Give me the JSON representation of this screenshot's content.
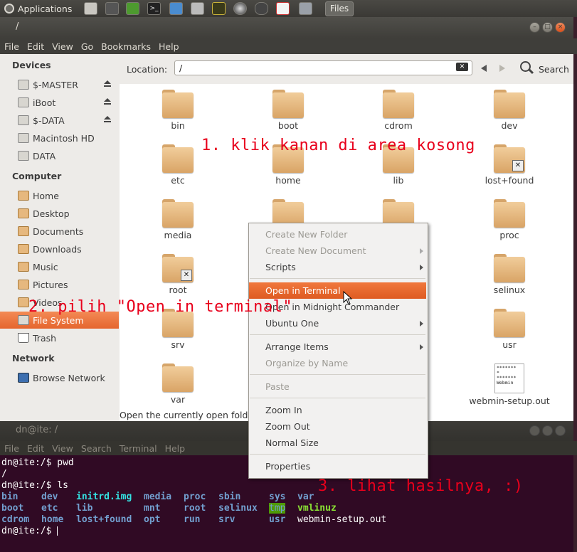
{
  "panel": {
    "applications_label": "Applications",
    "files_task": "Files"
  },
  "nautilus": {
    "title": "/",
    "menu": [
      "File",
      "Edit",
      "View",
      "Go",
      "Bookmarks",
      "Help"
    ],
    "location_label": "Location:",
    "location_value": "/",
    "search_label": "Search",
    "status": "Open the currently open folder in a terminal",
    "sidebar": {
      "devices_header": "Devices",
      "devices": [
        "$-MASTER",
        "iBoot",
        "$-DATA",
        "Macintosh HD",
        "DATA"
      ],
      "computer_header": "Computer",
      "computer": [
        "Home",
        "Desktop",
        "Documents",
        "Downloads",
        "Music",
        "Pictures",
        "Videos",
        "File System",
        "Trash"
      ],
      "network_header": "Network",
      "network": [
        "Browse Network"
      ]
    },
    "items": [
      "bin",
      "boot",
      "cdrom",
      "dev",
      "etc",
      "home",
      "lib",
      "lost+found",
      "media",
      "proc",
      "root",
      "selinux",
      "srv",
      "usr",
      "var",
      "webmin-setup.out"
    ],
    "textfile_preview": "*******\n*\n*******\nWebmin"
  },
  "context_menu": [
    "Create New Folder",
    "Create New Document",
    "Scripts",
    "Open in Terminal",
    "Open in Midnight Commander",
    "Ubuntu One",
    "Arrange Items",
    "Organize by Name",
    "Paste",
    "Zoom In",
    "Zoom Out",
    "Normal Size",
    "Properties"
  ],
  "terminal": {
    "title": "dn@ite: /",
    "menu": [
      "File",
      "Edit",
      "View",
      "Search",
      "Terminal",
      "Help"
    ],
    "prompt1": "dn@ite:/$ pwd",
    "out1": "/",
    "prompt2": "dn@ite:/$ ls",
    "ls": [
      [
        "bin",
        "dev",
        "initrd.img",
        "media",
        "proc",
        "sbin",
        "sys",
        "var"
      ],
      [
        "boot",
        "etc",
        "lib",
        "mnt",
        "root",
        "selinux",
        "tmp",
        "vmlinuz"
      ],
      [
        "cdrom",
        "home",
        "lost+found",
        "opt",
        "run",
        "srv",
        "usr",
        "webmin-setup.out"
      ]
    ],
    "prompt3": "dn@ite:/$ "
  },
  "annotations": {
    "step1": "1. klik kanan di area kosong",
    "step2": "2. pilih \"Open in terminal\"",
    "step3": "3. lihat hasilnya, :)"
  }
}
